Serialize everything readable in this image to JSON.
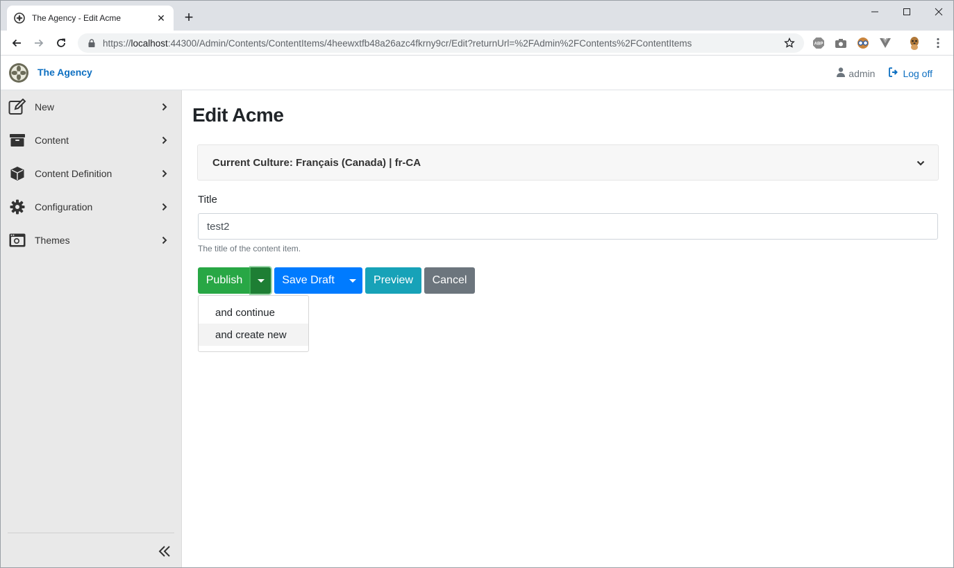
{
  "browser": {
    "tab_title": "The Agency - Edit Acme",
    "new_tab_label": "+",
    "url_prefix": "https://",
    "url_host": "localhost",
    "url_rest": ":44300/Admin/Contents/ContentItems/4heewxtfb48a26azc4fkrny9cr/Edit?returnUrl=%2FAdmin%2FContents%2FContentItems",
    "extensions": [
      "abp-extension-icon",
      "camera-extension-icon",
      "spectacles-extension-icon",
      "vuejs-extension-icon",
      "meerkat-profile-icon"
    ]
  },
  "header": {
    "brand": "The Agency",
    "user": "admin",
    "logoff": "Log off"
  },
  "sidebar": {
    "items": [
      {
        "label": "New",
        "icon": "edit-icon"
      },
      {
        "label": "Content",
        "icon": "archive-icon"
      },
      {
        "label": "Content Definition",
        "icon": "cube-icon"
      },
      {
        "label": "Configuration",
        "icon": "cog-icon"
      },
      {
        "label": "Themes",
        "icon": "window-icon"
      }
    ]
  },
  "main": {
    "title": "Edit Acme",
    "culture": "Current Culture: Français (Canada) | fr-CA",
    "field_label": "Title",
    "field_value": "test2",
    "field_hint": "The title of the content item.",
    "buttons": {
      "publish": "Publish",
      "save_draft": "Save Draft",
      "preview": "Preview",
      "cancel": "Cancel"
    },
    "dropdown": [
      "and continue",
      "and create new"
    ]
  },
  "colors": {
    "publish": "#28a745",
    "publish_toggle": "#1e7e34",
    "save_draft": "#007bff",
    "preview": "#17a2b8",
    "cancel": "#6c757d",
    "brand": "#0d6fc1",
    "sidebar_bg": "#e9e9e9"
  }
}
